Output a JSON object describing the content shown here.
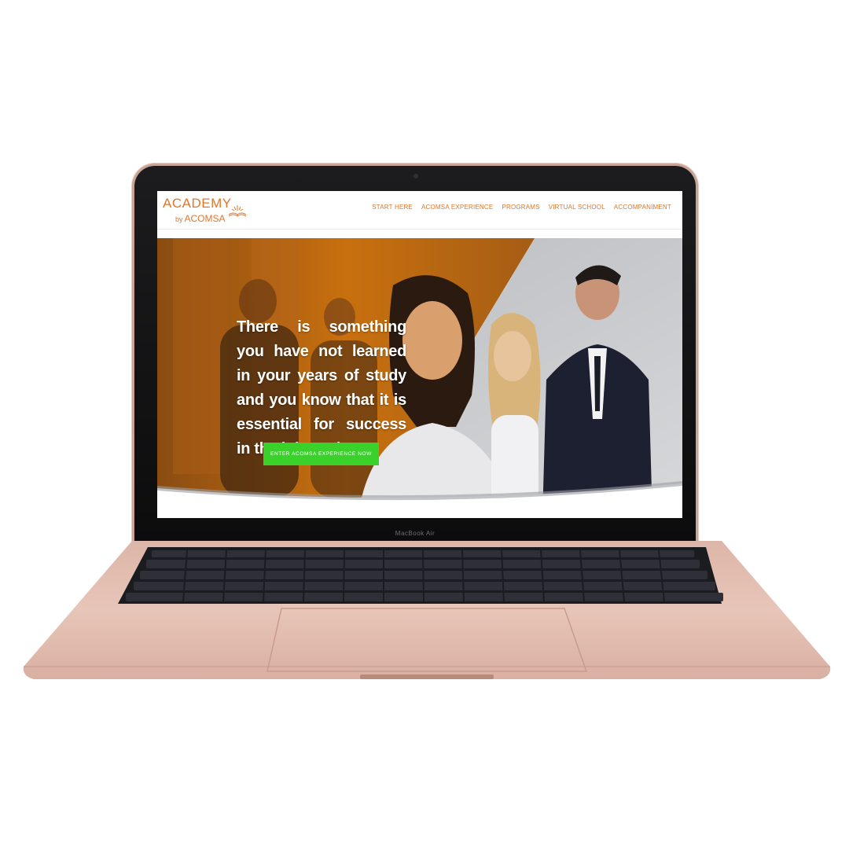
{
  "device": {
    "label": "MacBook Air"
  },
  "site": {
    "logo": {
      "main": "ACADEMY",
      "by": "by",
      "sub": "ACOMSA"
    },
    "nav": [
      {
        "label": "START HERE"
      },
      {
        "label": "ACOMSA EXPERIENCE"
      },
      {
        "label": "PROGRAMS"
      },
      {
        "label": "VIRTUAL SCHOOL"
      },
      {
        "label": "ACCOMPANIMENT"
      }
    ],
    "hero": {
      "headline": "There is something you have not learned in your years of study and you know that it is essential for success in the job market",
      "cta_label": "ENTER ACOMSA EXPERIENCE NOW"
    }
  },
  "colors": {
    "accent": "#e0762a",
    "cta": "#3ad12b",
    "laptop": "#e5c4b8"
  }
}
